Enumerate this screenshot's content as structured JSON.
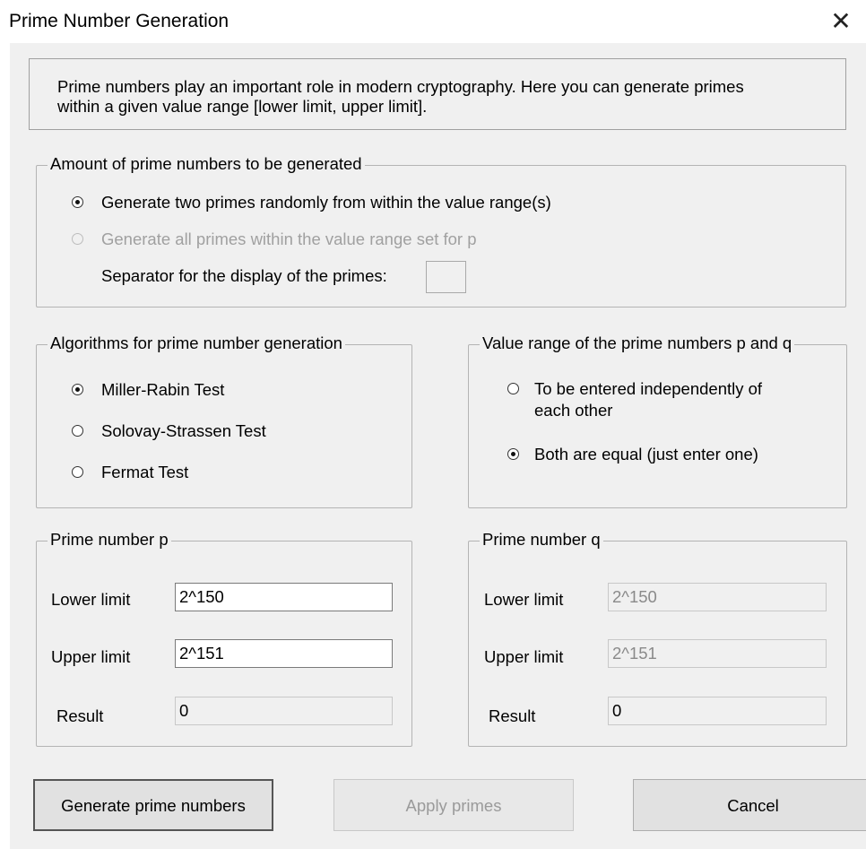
{
  "window": {
    "title": "Prime Number Generation",
    "close_glyph": "✕"
  },
  "info": {
    "line1": "Prime numbers play an important role in modern cryptography. Here you can generate primes",
    "line2": "within a given value range [lower limit, upper limit]."
  },
  "amount": {
    "legend": "Amount of prime numbers to be generated",
    "option_random": "Generate two primes randomly from within the value range(s)",
    "option_all": "Generate all primes within the value range set for p",
    "separator_label": "Separator for the display of the primes:",
    "separator_value": ""
  },
  "algorithms": {
    "legend": "Algorithms for prime number generation",
    "options": [
      "Miller-Rabin Test",
      "Solovay-Strassen Test",
      "Fermat Test"
    ],
    "selected_index": 0
  },
  "value_range": {
    "legend": "Value range of the prime numbers p and q",
    "option_independent_line1": "To be entered independently of",
    "option_independent_line2": "each other",
    "option_equal": "Both are equal (just enter one)"
  },
  "prime_p": {
    "legend": "Prime number p",
    "lower_label": "Lower limit",
    "lower_value": "2^150",
    "upper_label": "Upper limit",
    "upper_value": "2^151",
    "result_label": "Result",
    "result_value": "0"
  },
  "prime_q": {
    "legend": "Prime number q",
    "lower_label": "Lower limit",
    "lower_value": "2^150",
    "upper_label": "Upper limit",
    "upper_value": "2^151",
    "result_label": "Result",
    "result_value": "0"
  },
  "buttons": {
    "generate": "Generate prime numbers",
    "apply": "Apply primes",
    "cancel": "Cancel"
  }
}
